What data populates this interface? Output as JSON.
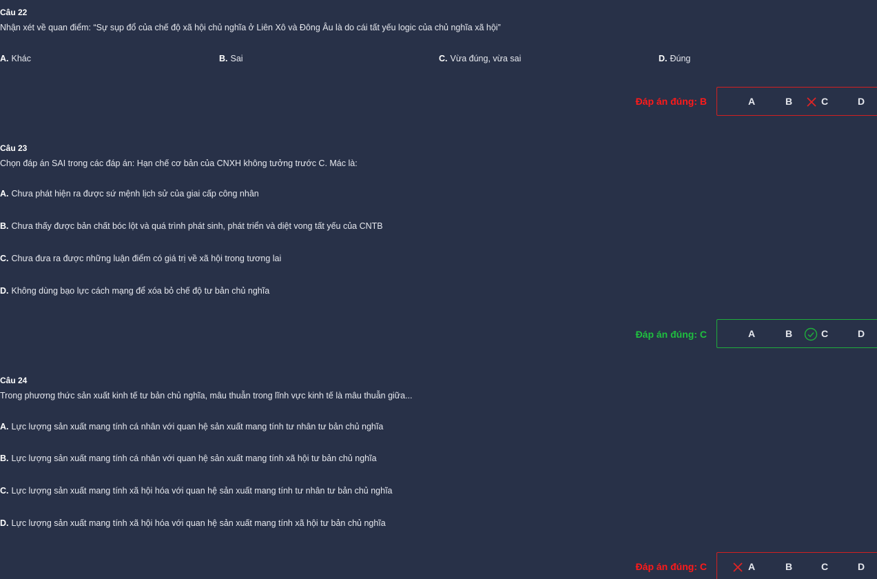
{
  "questions": [
    {
      "title": "Câu 22",
      "text": "Nhận xét về quan điểm: “Sự sụp đổ của chế độ xã hội chủ nghĩa ở Liên Xô và Đông Âu là do cái tất yếu logic của chủ nghĩa xã hội”",
      "options": [
        {
          "letter": "A.",
          "text": "Khác"
        },
        {
          "letter": "B.",
          "text": "Sai"
        },
        {
          "letter": "C.",
          "text": "Vừa đúng, vừa sai"
        },
        {
          "letter": "D.",
          "text": "Đúng"
        }
      ],
      "correct_label": "Đáp án đúng: B",
      "selected": "C",
      "result": "wrong",
      "choices": [
        "A",
        "B",
        "C",
        "D"
      ]
    },
    {
      "title": "Câu 23",
      "text": "Chọn đáp án SAI trong các đáp án: Hạn chế cơ bản của CNXH không tưởng trước C. Mác là:",
      "options": [
        {
          "letter": "A.",
          "text": "Chưa phát hiện ra được sứ mệnh lịch sử của giai cấp công nhân"
        },
        {
          "letter": "B.",
          "text": "Chưa thấy được bản chất bóc lột và quá trình phát sinh, phát triển và diệt vong tất yếu của CNTB"
        },
        {
          "letter": "C.",
          "text": "Chưa đưa ra được những luận điểm có giá trị về xã hội trong tương lai"
        },
        {
          "letter": "D.",
          "text": "Không dùng bạo lực cách mạng để xóa bỏ chế độ tư bản chủ nghĩa"
        }
      ],
      "correct_label": "Đáp án đúng: C",
      "selected": "C",
      "result": "correct",
      "choices": [
        "A",
        "B",
        "C",
        "D"
      ]
    },
    {
      "title": "Câu 24",
      "text": "Trong phương thức sản xuất kinh tế tư bản chủ nghĩa, mâu thuẫn trong lĩnh vực kinh tế là mâu thuẫn giữa...",
      "options": [
        {
          "letter": "A.",
          "text": "Lực lượng sản xuất mang tính cá nhân với quan hệ sản xuất mang tính tư nhân tư bản chủ nghĩa"
        },
        {
          "letter": "B.",
          "text": "Lực lượng sản xuất mang tính cá nhân với quan hệ sản xuất mang tính xã hội tư bản chủ nghĩa"
        },
        {
          "letter": "C.",
          "text": "Lực lượng sản xuất mang tính xã hội hóa với quan hệ sản xuất mang tính tư nhân tư bản chủ nghĩa"
        },
        {
          "letter": "D.",
          "text": "Lực lượng sản xuất mang tính xã hội hóa với quan hệ sản xuất mang tính xã hội tư bản chủ nghĩa"
        }
      ],
      "correct_label": "Đáp án đúng: C",
      "selected": "A",
      "result": "wrong",
      "choices": [
        "A",
        "B",
        "C",
        "D"
      ]
    }
  ],
  "colors": {
    "background": "#283148",
    "wrong": "#ff1a1a",
    "correct": "#1fbf3f"
  },
  "icons": {
    "wrong_mark": "x-mark-icon",
    "correct_mark": "check-circle-icon"
  }
}
